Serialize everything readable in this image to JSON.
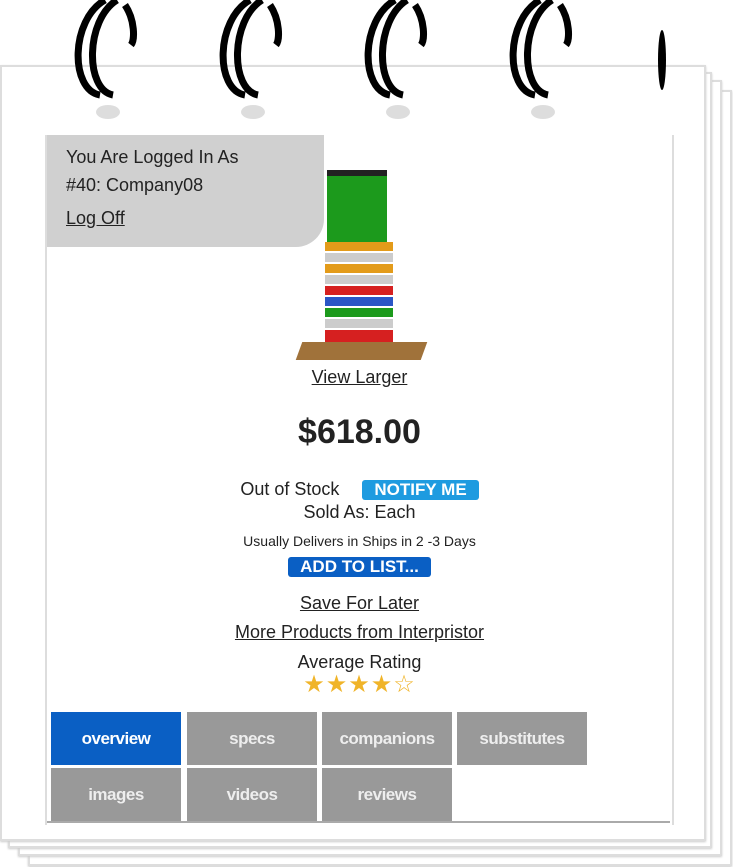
{
  "login": {
    "line1": "You Are Logged In As",
    "line2": "#40: Company08",
    "logoff": "Log Off"
  },
  "product": {
    "image_icon": "product-bin-stack-image",
    "view_larger": "View Larger",
    "price": "$618.00",
    "stock": "Out of Stock",
    "notify": "NOTIFY ME",
    "sold_as": "Sold As: Each",
    "delivery": "Usually Delivers in Ships in 2 -3 Days",
    "add_to_list": "ADD TO LIST...",
    "save_later": "Save For Later",
    "more_products": "More Products from Interpristor",
    "rating_label": "Average Rating",
    "rating": 4,
    "rating_max": 5
  },
  "tabs": [
    {
      "label": "overview",
      "active": true
    },
    {
      "label": "specs"
    },
    {
      "label": "companions"
    },
    {
      "label": "substitutes"
    },
    {
      "label": "images"
    },
    {
      "label": "videos"
    },
    {
      "label": "reviews"
    }
  ],
  "colors": {
    "active_tab": "#0a5fc4",
    "tab": "#999999",
    "notify": "#1e9be0",
    "add_to_list": "#0a5fc4",
    "login_bg": "#d0d0d0"
  }
}
